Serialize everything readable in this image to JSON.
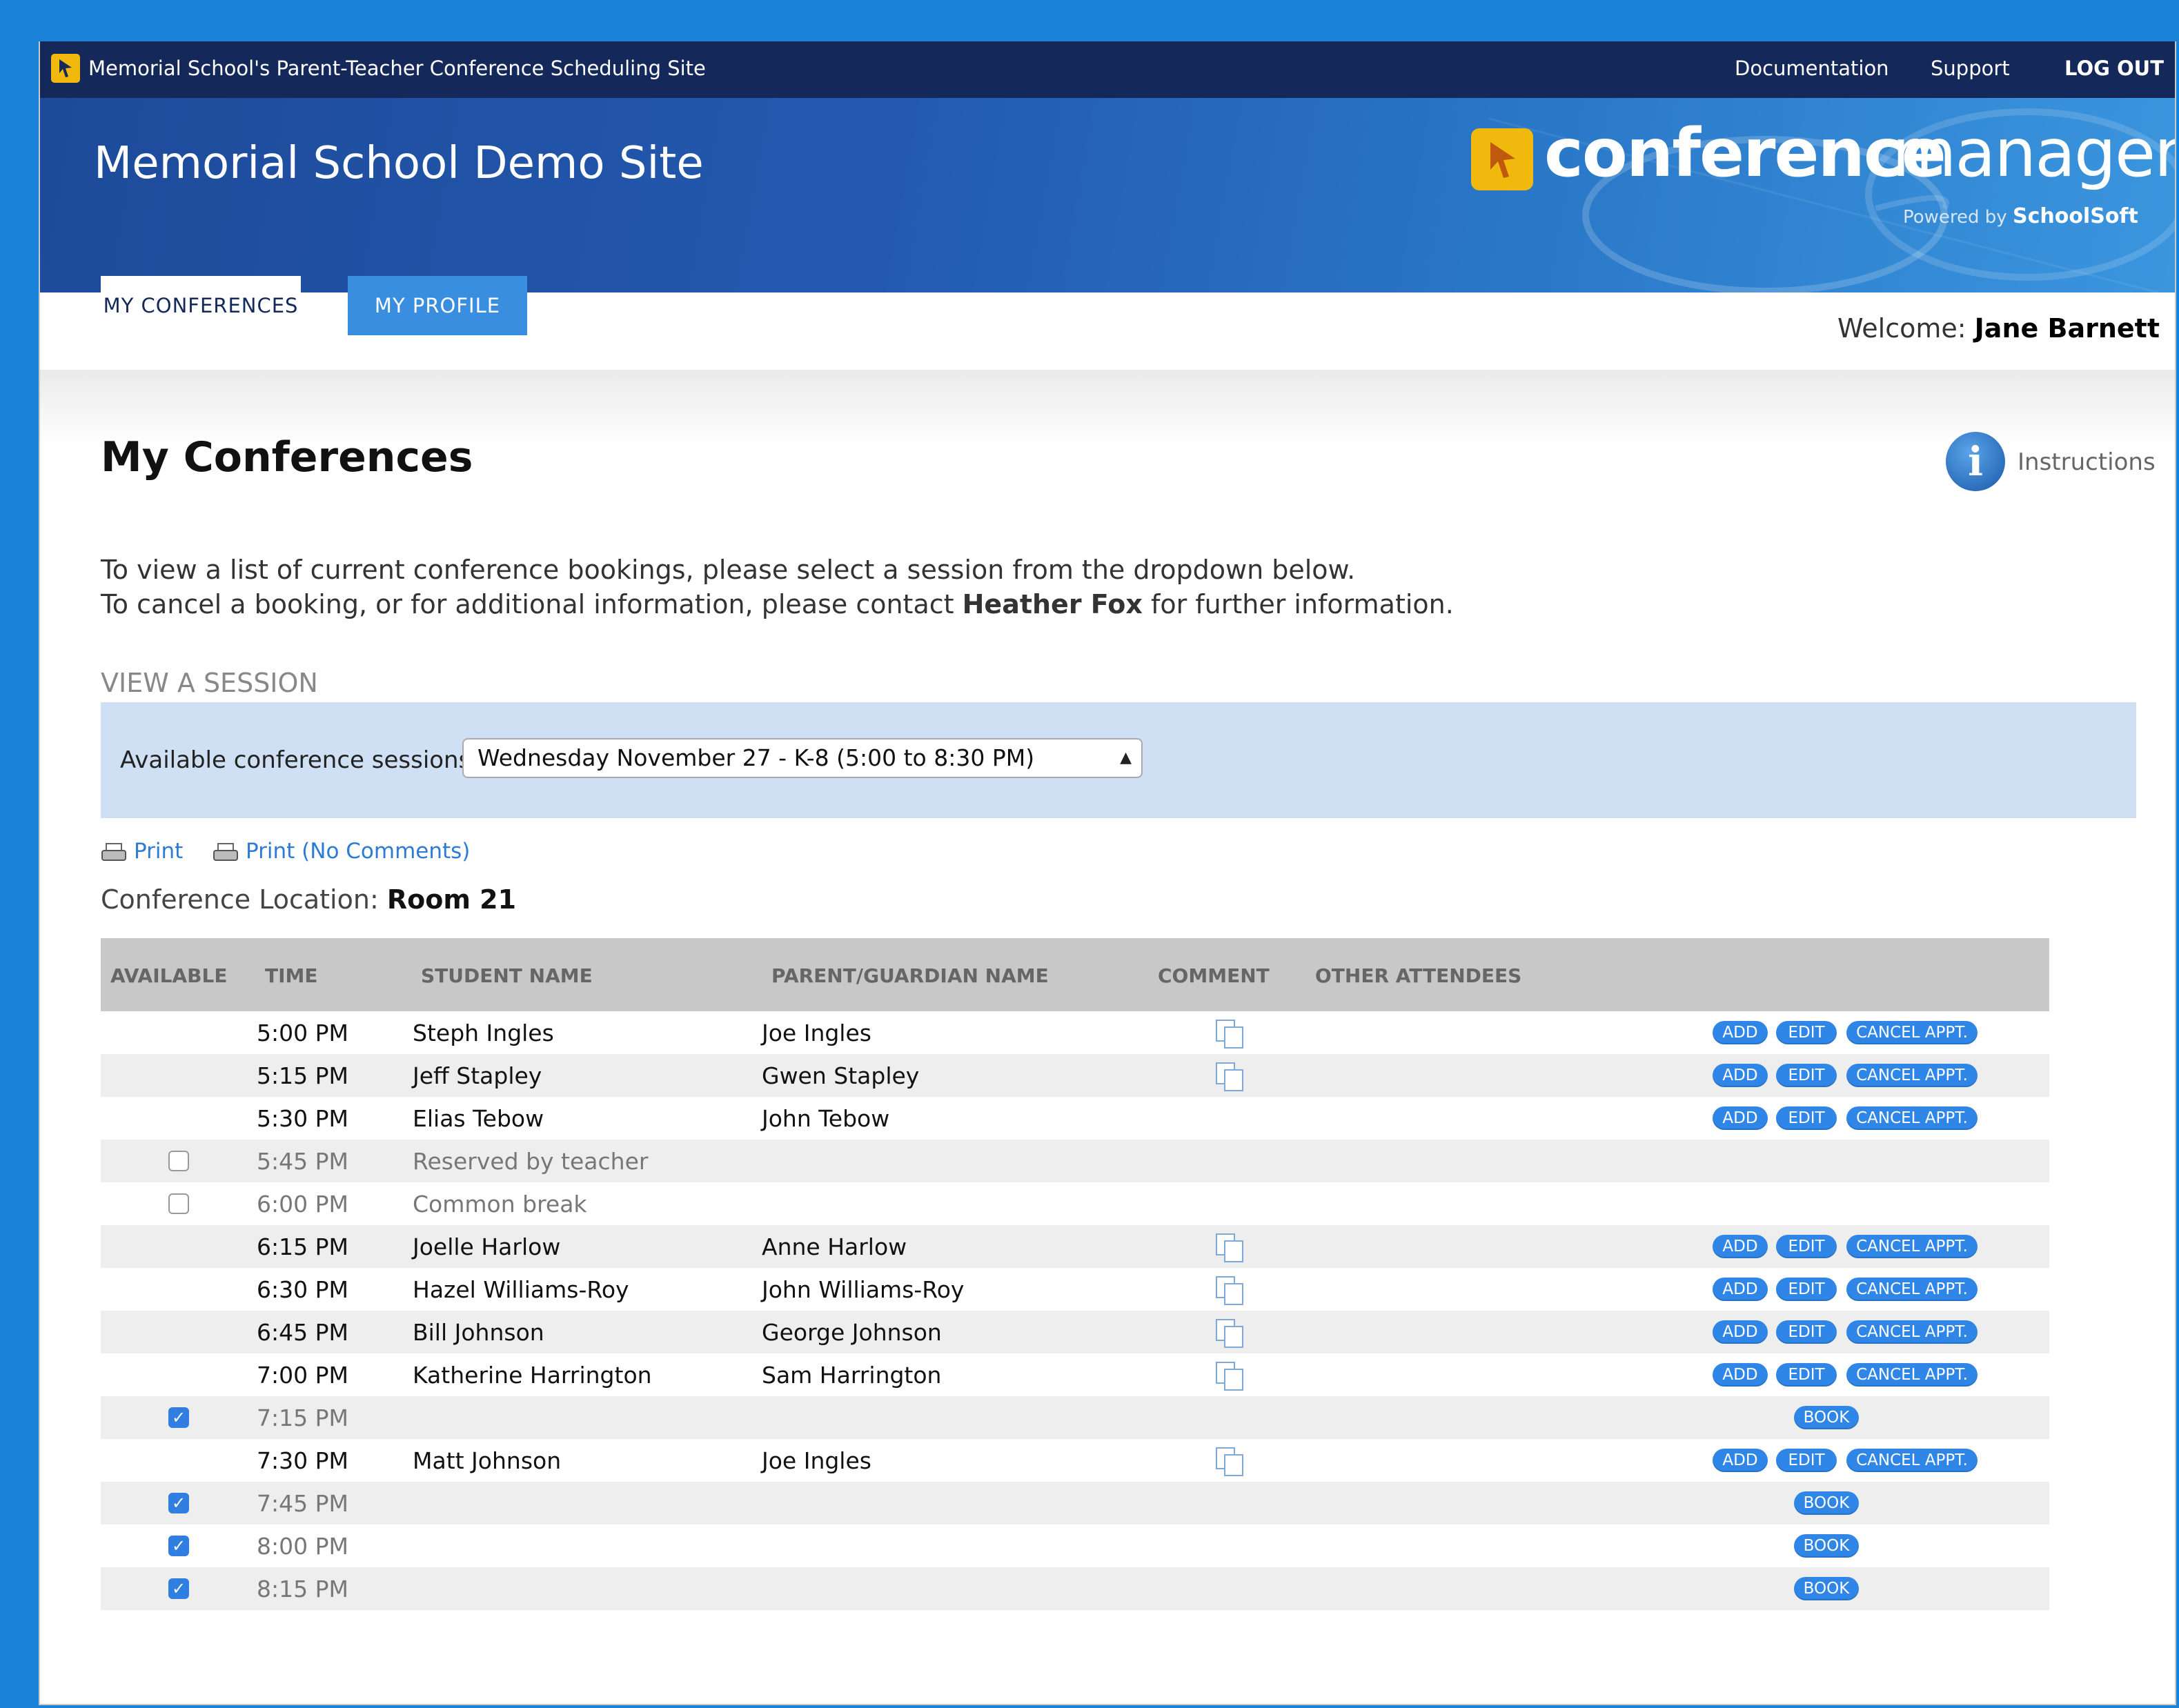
{
  "topbar": {
    "site_name": "Memorial School's Parent-Teacher Conference Scheduling Site",
    "links": {
      "documentation": "Documentation",
      "support": "Support",
      "logout": "LOG OUT"
    }
  },
  "banner": {
    "title": "Memorial School Demo Site",
    "brand_bold": "conference",
    "brand_light": "manager",
    "powered_by": "Powered by",
    "powered_company": "SchoolSoft"
  },
  "tabs": {
    "my_conferences": "MY CONFERENCES",
    "my_profile": "MY PROFILE"
  },
  "welcome": {
    "label": "Welcome:",
    "name": "Jane Barnett"
  },
  "page": {
    "title": "My Conferences",
    "instructions_label": "Instructions",
    "intro_line1": "To view a list of current conference bookings, please select a session from the dropdown below.",
    "intro_line2_pre": "To cancel a booking, or for additional information, please contact",
    "intro_contact": "Heather Fox",
    "intro_line2_post": "for further information."
  },
  "session": {
    "heading": "VIEW A SESSION",
    "label": "Available conference sessions",
    "selected": "Wednesday November 27 - K-8 (5:00 to 8:30 PM)"
  },
  "print": {
    "print": "Print",
    "print_no_comments": "Print (No Comments)"
  },
  "location": {
    "label": "Conference Location:",
    "value": "Room 21"
  },
  "table": {
    "headers": {
      "available": "AVAILABLE",
      "time": "TIME",
      "student": "STUDENT NAME",
      "parent": "PARENT/GUARDIAN NAME",
      "comment": "COMMENT",
      "other": "OTHER ATTENDEES"
    },
    "buttons": {
      "add": "ADD",
      "edit": "EDIT",
      "cancel": "CANCEL APPT.",
      "book": "BOOK"
    },
    "rows": [
      {
        "time": "5:00 PM",
        "student": "Steph Ingles",
        "parent": "Joe Ingles"
      },
      {
        "time": "5:15 PM",
        "student": "Jeff Stapley",
        "parent": "Gwen Stapley"
      },
      {
        "time": "5:30 PM",
        "student": "Elias Tebow",
        "parent": "John Tebow"
      },
      {
        "time": "5:45 PM",
        "student": "Reserved by teacher",
        "available": false
      },
      {
        "time": "6:00 PM",
        "student": "Common break",
        "available": false
      },
      {
        "time": "6:15 PM",
        "student": "Joelle Harlow",
        "parent": "Anne Harlow"
      },
      {
        "time": "6:30 PM",
        "student": "Hazel Williams-Roy",
        "parent": "John Williams-Roy"
      },
      {
        "time": "6:45 PM",
        "student": "Bill Johnson",
        "parent": "George Johnson"
      },
      {
        "time": "7:00 PM",
        "student": "Katherine Harrington",
        "parent": "Sam Harrington"
      },
      {
        "time": "7:15 PM",
        "available": true
      },
      {
        "time": "7:30 PM",
        "student": "Matt Johnson",
        "parent": "Joe Ingles"
      },
      {
        "time": "7:45 PM",
        "available": true
      },
      {
        "time": "8:00 PM",
        "available": true
      },
      {
        "time": "8:15 PM",
        "available": true
      }
    ]
  },
  "colors": {
    "topbar": "#15285a",
    "tab_active_text": "#15285a",
    "tab_inactive_bg": "#3a8ee0",
    "session_box": "#cfe0f4",
    "button_blue": "#2f86e6",
    "logo_yellow": "#f1b90e"
  }
}
